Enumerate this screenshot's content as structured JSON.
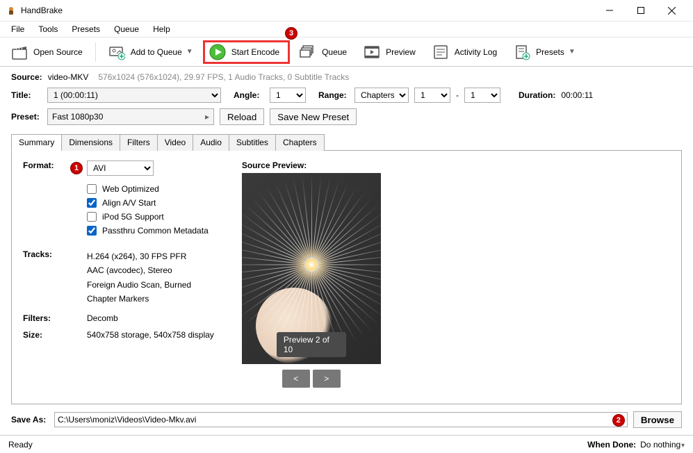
{
  "titlebar": {
    "app_name": "HandBrake"
  },
  "menubar": {
    "items": [
      "File",
      "Tools",
      "Presets",
      "Queue",
      "Help"
    ]
  },
  "toolbar": {
    "open_source": "Open Source",
    "add_to_queue": "Add to Queue",
    "start_encode": "Start Encode",
    "queue": "Queue",
    "preview": "Preview",
    "activity_log": "Activity Log",
    "presets": "Presets"
  },
  "annotations": {
    "a1": "1",
    "a2": "2",
    "a3": "3"
  },
  "source": {
    "label": "Source:",
    "name": "video-MKV",
    "details": "576x1024 (576x1024), 29.97 FPS, 1 Audio Tracks, 0 Subtitle Tracks"
  },
  "title": {
    "label": "Title:",
    "value": "1  (00:00:11)"
  },
  "angle": {
    "label": "Angle:",
    "value": "1"
  },
  "range": {
    "label": "Range:",
    "type": "Chapters",
    "from": "1",
    "to": "1",
    "dash": "-"
  },
  "duration": {
    "label": "Duration:",
    "value": "00:00:11"
  },
  "preset": {
    "label": "Preset:",
    "value": "Fast 1080p30",
    "reload": "Reload",
    "save_new": "Save New Preset"
  },
  "tabs": [
    "Summary",
    "Dimensions",
    "Filters",
    "Video",
    "Audio",
    "Subtitles",
    "Chapters"
  ],
  "summary": {
    "format_label": "Format:",
    "format_value": "AVI",
    "checks": {
      "web_optimized": "Web Optimized",
      "align_av": "Align A/V Start",
      "ipod": "iPod 5G Support",
      "passthru": "Passthru Common Metadata"
    },
    "tracks_label": "Tracks:",
    "tracks": [
      "H.264 (x264), 30 FPS PFR",
      "AAC (avcodec), Stereo",
      "Foreign Audio Scan, Burned",
      "Chapter Markers"
    ],
    "filters_label": "Filters:",
    "filters_value": "Decomb",
    "size_label": "Size:",
    "size_value": "540x758 storage, 540x758 display"
  },
  "preview": {
    "title": "Source Preview:",
    "badge": "Preview 2 of 10",
    "prev": "<",
    "next": ">"
  },
  "save": {
    "label": "Save As:",
    "path": "C:\\Users\\moniz\\Videos\\Video-Mkv.avi",
    "browse": "Browse"
  },
  "status": {
    "ready": "Ready",
    "when_done_label": "When Done:",
    "when_done_value": "Do nothing"
  }
}
